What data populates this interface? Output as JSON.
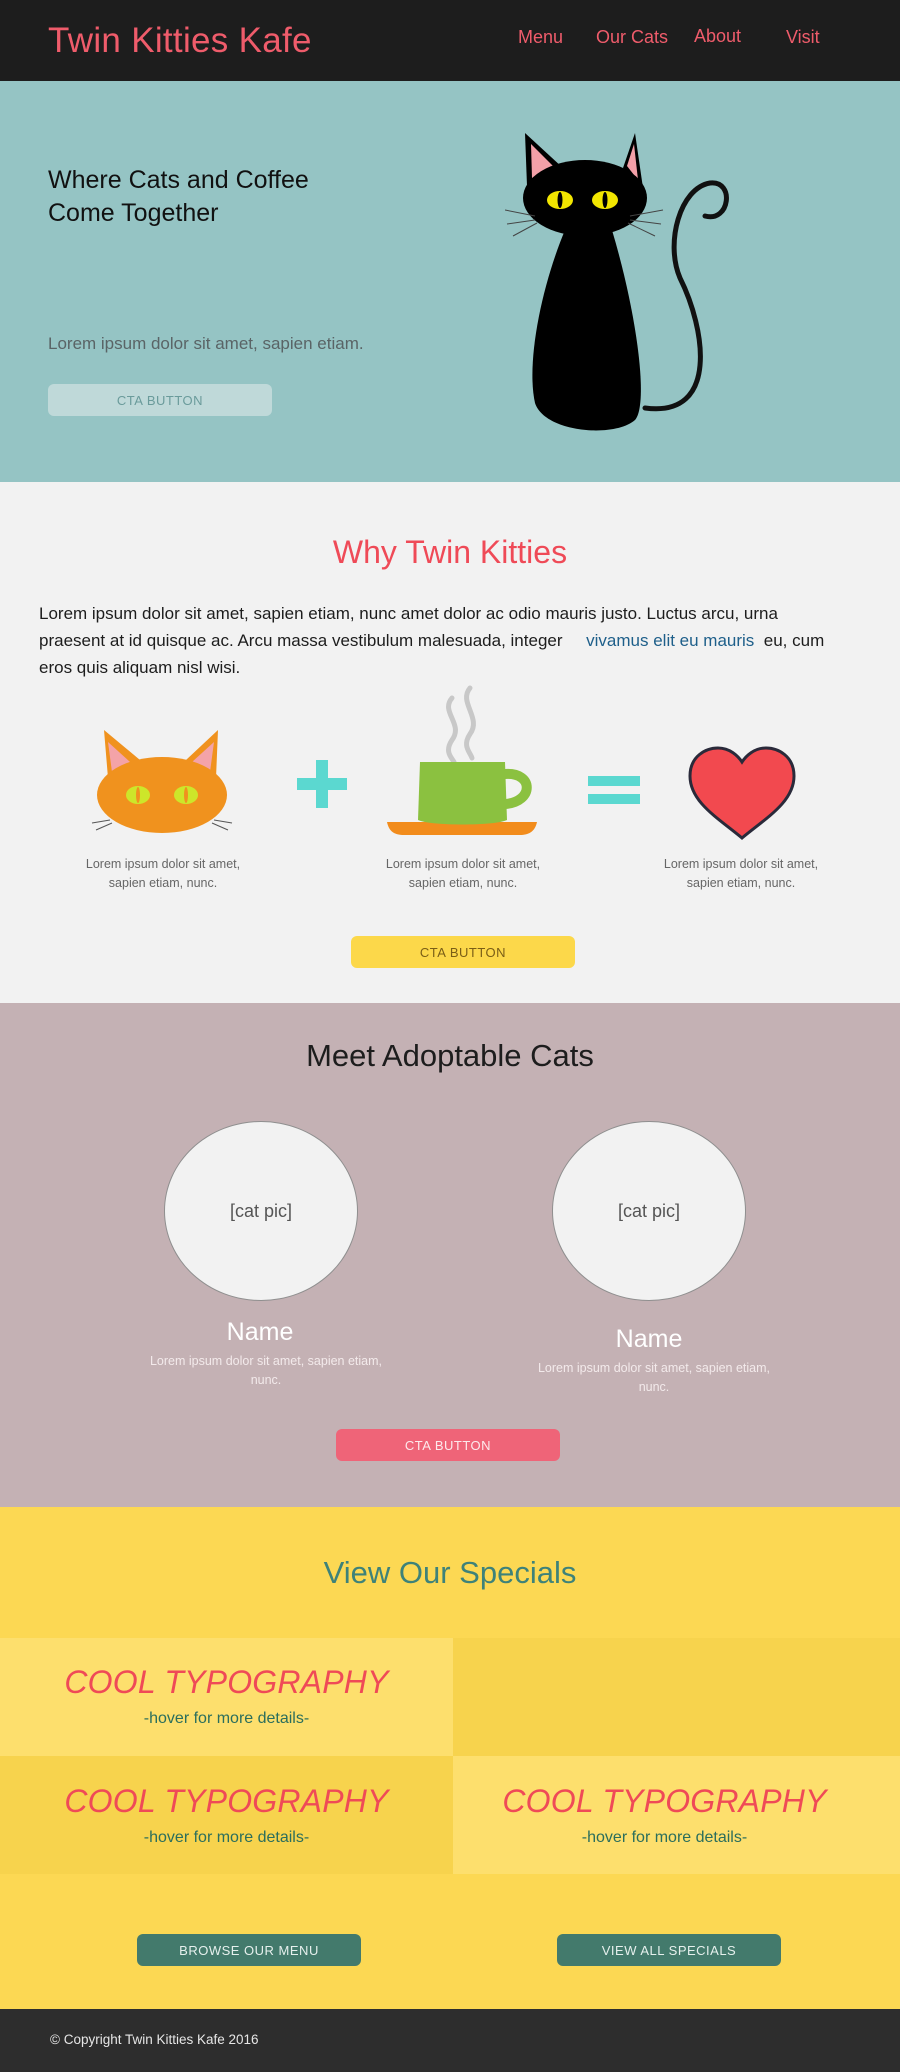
{
  "header": {
    "brand": "Twin Kitties Kafe",
    "nav": [
      "Menu",
      "Our Cats",
      "About",
      "Visit"
    ]
  },
  "hero": {
    "title": "Where Cats and Coffee Come Together",
    "subtitle": "Lorem ipsum dolor sit amet, sapien etiam.",
    "cta": "CTA BUTTON"
  },
  "why": {
    "title": "Why Twin Kitties",
    "para_before_link": "Lorem ipsum dolor sit amet, sapien etiam, nunc amet dolor ac odio mauris justo. Luctus arcu, urna praesent at id quisque ac. Arcu massa vestibulum malesuada, integer",
    "link": "vivamus elit eu mauris",
    "para_after_link": "eu, cum eros quis aliquam nisl wisi.",
    "captions": [
      "Lorem ipsum dolor sit amet, sapien etiam, nunc.",
      "Lorem ipsum dolor sit amet, sapien etiam, nunc.",
      "Lorem ipsum dolor sit amet, sapien etiam, nunc."
    ],
    "cta": "CTA BUTTON"
  },
  "adopt": {
    "title": "Meet Adoptable Cats",
    "cats": [
      {
        "pic": "[cat pic]",
        "name": "Name",
        "desc": "Lorem ipsum dolor sit amet, sapien etiam, nunc."
      },
      {
        "pic": "[cat pic]",
        "name": "Name",
        "desc": "Lorem ipsum dolor sit amet, sapien etiam, nunc."
      }
    ],
    "cta": "CTA BUTTON"
  },
  "specials": {
    "title": "View Our Specials",
    "tiles": [
      {
        "heading": "COOL TYPOGRAPHY",
        "sub": "-hover for more details-"
      },
      {
        "heading": "COOL TYPOGRAPHY",
        "sub": "-hover for more details-"
      },
      {
        "heading": "COOL TYPOGRAPHY",
        "sub": "-hover for more details-"
      }
    ],
    "browse_menu": "BROWSE OUR MENU",
    "view_specials": "VIEW ALL SPECIALS"
  },
  "footer": {
    "copyright": "© Copyright Twin Kitties Kafe 2016"
  },
  "colors": {
    "brand_pink": "#ef5c6b",
    "hero_teal": "#95c4c4",
    "adopt_mauve": "#c4b1b4",
    "specials_yellow": "#fcd853",
    "button_green": "#437a6c"
  },
  "icons": [
    "black-cat-illustration",
    "orange-cat-icon",
    "plus-icon",
    "coffee-cup-icon",
    "equals-icon",
    "heart-icon"
  ]
}
